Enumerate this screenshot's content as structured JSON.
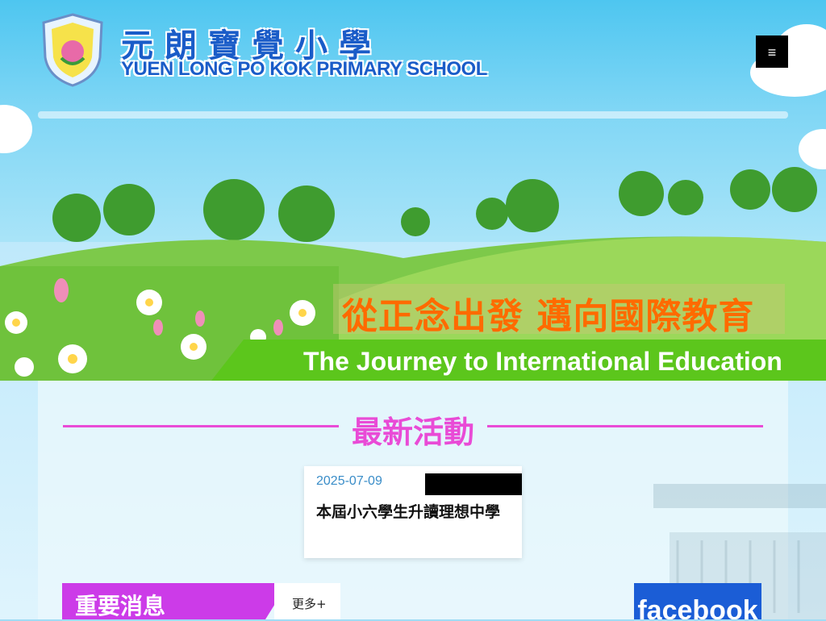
{
  "header": {
    "school_name_zh": "元朗寶覺小學",
    "school_name_en": "YUEN LONG PO KOK PRIMARY SCHOOL",
    "logo_text": "寶覺小學",
    "menu_icon": "hamburger-icon",
    "menu_glyph": "≡"
  },
  "hero": {
    "slogan_zh": "從正念出發 邁向國際教育",
    "slogan_en": "The Journey to International Education"
  },
  "latest_activities": {
    "title": "最新活動",
    "items": [
      {
        "date": "2025-07-09",
        "title": "本屆小六學生升讀理想中學"
      }
    ]
  },
  "news": {
    "title": "重要消息",
    "more_label": "更多+"
  },
  "social": {
    "facebook_label": "facebook"
  },
  "colors": {
    "brand_blue": "#1a5cc8",
    "accent_pink": "#e94bd6",
    "news_purple": "#cc3be8",
    "slogan_orange": "#ff6a00",
    "slogan_green": "#5cc61c",
    "facebook_blue": "#1b5dd6"
  }
}
